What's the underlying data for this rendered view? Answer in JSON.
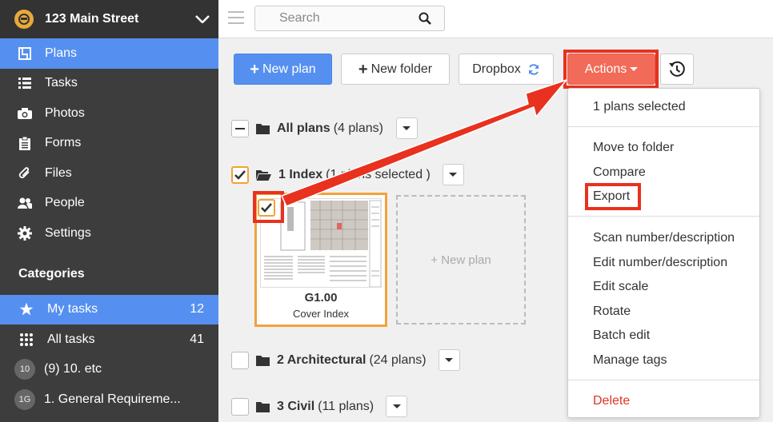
{
  "sidebar": {
    "project_name": "123 Main Street",
    "nav": [
      {
        "label": "Plans"
      },
      {
        "label": "Tasks"
      },
      {
        "label": "Photos"
      },
      {
        "label": "Forms"
      },
      {
        "label": "Files"
      },
      {
        "label": "People"
      },
      {
        "label": "Settings"
      }
    ],
    "categories_title": "Categories",
    "categories": [
      {
        "label": "My tasks",
        "count": "12"
      },
      {
        "label": "All tasks",
        "count": "41"
      },
      {
        "label": "(9) 10. etc",
        "badge": "10"
      },
      {
        "label": "1. General Requireme...",
        "badge": "1G"
      }
    ]
  },
  "topbar": {
    "search_placeholder": "Search"
  },
  "toolbar": {
    "new_plan": "New plan",
    "new_folder": "New folder",
    "dropbox": "Dropbox",
    "actions": "Actions"
  },
  "folders": {
    "all_plans": {
      "name": "All plans",
      "info": "(4 plans)"
    },
    "index": {
      "name": "1 Index",
      "info": "(1 plans selected )"
    },
    "architectural": {
      "name": "2 Architectural",
      "info": "(24 plans)"
    },
    "civil": {
      "name": "3 Civil",
      "info": "(11 plans)"
    }
  },
  "plan_card": {
    "number": "G1.00",
    "title": "Cover Index"
  },
  "new_plan_placeholder": "+ New plan",
  "actions_menu": {
    "status": "1 plans selected",
    "items": [
      "Move to folder",
      "Compare",
      "Export",
      "Scan number/description",
      "Edit number/description",
      "Edit scale",
      "Rotate",
      "Batch edit",
      "Manage tags"
    ],
    "delete": "Delete"
  },
  "colors": {
    "accent": "#5590f0",
    "actions": "#f26a58",
    "highlight": "#e8311e",
    "selected": "#f2a23a",
    "sidebar": "#3d3d3d"
  }
}
